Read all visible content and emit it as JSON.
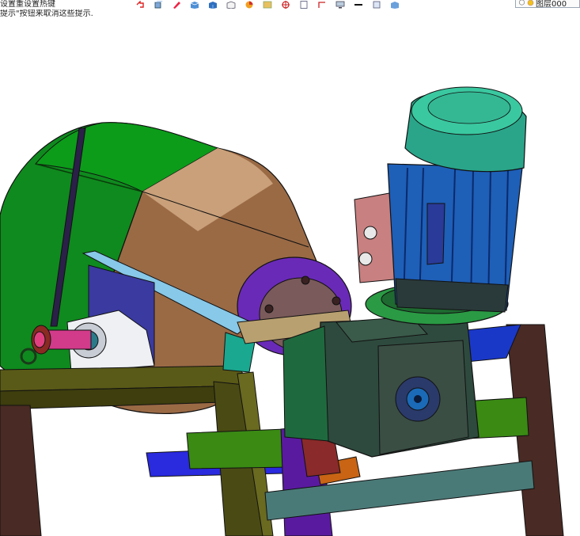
{
  "hint": {
    "line1": "设置重设置热键",
    "line2": "提示\"按钮来取消这些提示."
  },
  "toolbar": {
    "icons": [
      "undo-icon",
      "view-cube-icon",
      "pencil-icon",
      "box-icon",
      "cube-icon",
      "wire-cube-icon",
      "color-wheel-icon",
      "render-icon",
      "section-icon",
      "document-icon",
      "sketch-icon",
      "monitor-icon",
      "line-icon",
      "layer-sheet-icon",
      "sphere-cube-icon"
    ],
    "layer_label": "图层000"
  },
  "colors": {
    "drum_green": "#0f8a1e",
    "drum_bronze": "#9a6a45",
    "motor_blue": "#1e5fb8",
    "motor_cap": "#2aa58a",
    "gearbox": "#2e4a3e",
    "frame_olive": "#4a4a14",
    "frame_maroon": "#4a2a22",
    "flange_purple": "#6a2ab8"
  }
}
